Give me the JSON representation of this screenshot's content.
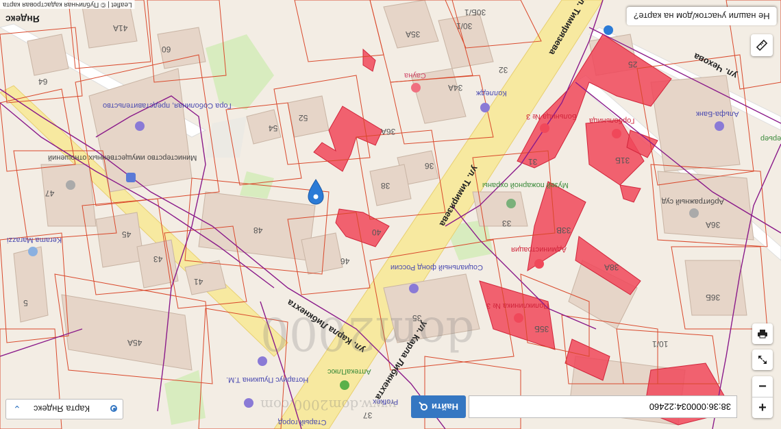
{
  "map": {
    "attribution": "Leaflet | © Публичная кадастровая карта",
    "provider_logo": "Яндекс",
    "street_labels": [
      "ул. Тимирязева",
      "ул. Тимирязева",
      "ул. Карла Либкнехта",
      "ул. Карла Либкнехта",
      "ул. Чехова"
    ],
    "house_numbers": [
      "41А",
      "60",
      "64",
      "30/1",
      "30Б/1",
      "35А",
      "34А",
      "32",
      "52",
      "54",
      "36А",
      "36",
      "38",
      "25",
      "31",
      "31Б",
      "47",
      "48",
      "45",
      "43",
      "41",
      "46",
      "40",
      "33",
      "33В",
      "38А",
      "36Б",
      "36А",
      "35",
      "35Б",
      "10/1",
      "45А",
      "5",
      "37",
      "45"
    ],
    "poi_labels": [
      "Гора Соболиная, представительство",
      "Министерство имущественных отношений",
      "Сауна",
      "Колледж",
      "Больница № 3",
      "Горбольница",
      "Музей пожарной охраны",
      "Арбитражный суд",
      "Социальный фонд России",
      "Администрация",
      "Поликлиника № 3",
      "Альфа-Банк",
      "Keramа Marazzi",
      "АптекаПлюс",
      "Нотариус Пушкина Т.М.",
      "Старый город",
      "Profkex",
      "Интерьер"
    ],
    "watermark": "dom2000",
    "watermark_url": "www.dom2000.com"
  },
  "controls": {
    "not_found_label": "Не нашли участок/дом на карте?",
    "ruler_icon": "ruler-icon",
    "print_icon": "print-icon",
    "fullscreen_icon": "fullscreen-icon",
    "zoom_in_label": "+",
    "zoom_out_label": "−"
  },
  "search": {
    "value": "38:36:000034:22460",
    "button_label": "Найти",
    "button_icon": "search-icon"
  },
  "layer_switcher": {
    "selected": "Карта Яндекс",
    "chevron_icon": "chevron-up-icon"
  },
  "colors": {
    "background": "#f3ede4",
    "building": "#e6d5c8",
    "parcel_border": "#d9482b",
    "highlighted_parcel": "#f0485a",
    "boundary": "#8a1a8a",
    "road": "#f7e9a0",
    "park": "#d8ecbf",
    "marker": "#2b7bd6",
    "search_button": "#3577c2"
  }
}
